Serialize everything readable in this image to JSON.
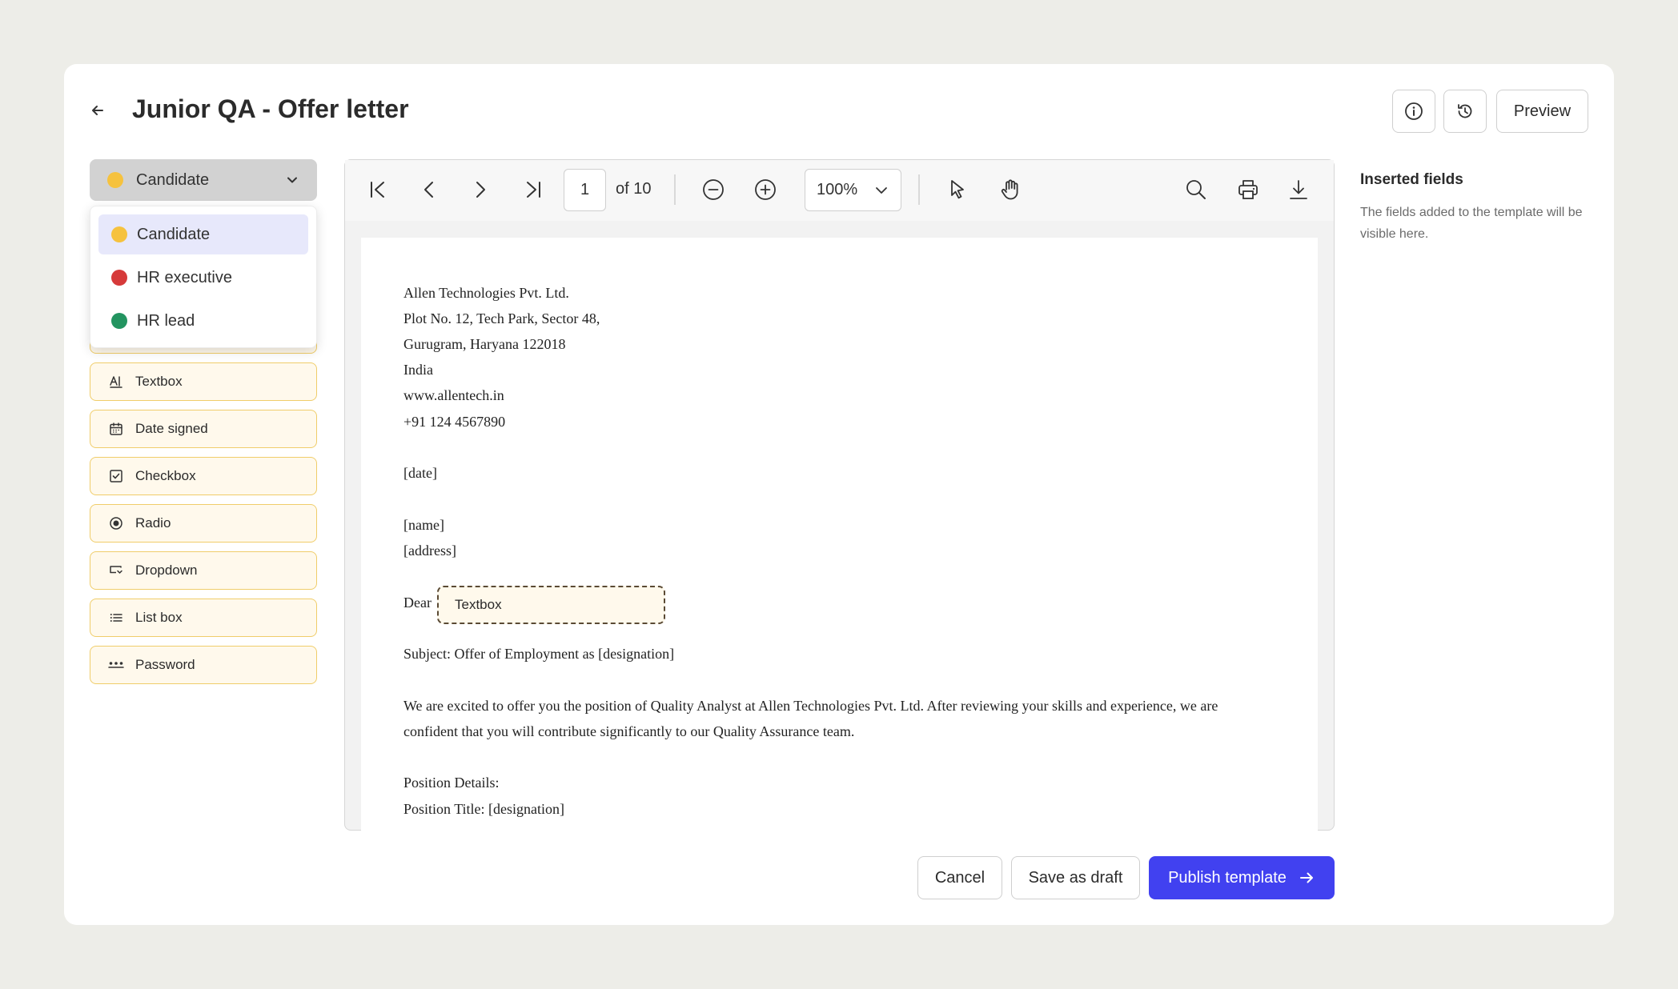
{
  "header": {
    "title": "Junior QA - Offer letter",
    "preview_label": "Preview"
  },
  "icons": {
    "back": "arrow-left-icon",
    "info": "info-icon",
    "history": "history-icon"
  },
  "role_selector": {
    "selected": "Candidate",
    "selected_color": "#f6c23e",
    "options": [
      {
        "label": "Candidate",
        "color": "#f6c23e",
        "active": true
      },
      {
        "label": "HR executive",
        "color": "#d63a3a",
        "active": false
      },
      {
        "label": "HR lead",
        "color": "#239460",
        "active": false
      }
    ]
  },
  "fields": [
    {
      "label": "Textbox",
      "icon": "textbox-icon"
    },
    {
      "label": "Date signed",
      "icon": "calendar-icon"
    },
    {
      "label": "Checkbox",
      "icon": "checkbox-icon"
    },
    {
      "label": "Radio",
      "icon": "radio-icon"
    },
    {
      "label": "Dropdown",
      "icon": "dropdown-icon"
    },
    {
      "label": "List box",
      "icon": "list-icon"
    },
    {
      "label": "Password",
      "icon": "password-icon"
    }
  ],
  "viewer": {
    "page": "1",
    "of_pages": "of 10",
    "zoom": "100%"
  },
  "document": {
    "lines": [
      "Allen Technologies Pvt. Ltd.",
      "Plot No. 12, Tech Park, Sector 48,",
      "Gurugram, Haryana 122018",
      "India",
      "www.allentech.in",
      "+91 124 4567890",
      "[date]",
      "[name]",
      "[address]",
      "Dear",
      "Subject: Offer of Employment as [designation]",
      "We are excited to offer you the position of Quality Analyst at Allen Technologies Pvt. Ltd. After reviewing your skills and experience, we are",
      "confident that you will contribute significantly to our Quality Assurance team.",
      "Position Details:",
      "Position Title: [designation]"
    ],
    "inline_field_label": "Textbox"
  },
  "inserted_fields": {
    "title": "Inserted fields",
    "description": "The fields added to the template will be visible here."
  },
  "footer": {
    "cancel": "Cancel",
    "save_draft": "Save as draft",
    "publish": "Publish template"
  }
}
